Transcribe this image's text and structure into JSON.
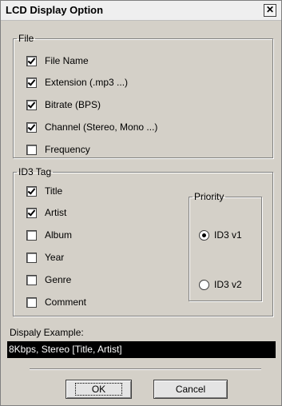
{
  "dialog": {
    "title": "LCD Display Option",
    "close_glyph": "✕"
  },
  "file_group": {
    "legend": "File",
    "items": [
      {
        "label": "File Name",
        "checked": true
      },
      {
        "label": "Extension (.mp3 ...)",
        "checked": true
      },
      {
        "label": "Bitrate (BPS)",
        "checked": true
      },
      {
        "label": "Channel (Stereo, Mono ...)",
        "checked": true
      },
      {
        "label": "Frequency",
        "checked": false
      }
    ]
  },
  "id3_group": {
    "legend": "ID3 Tag",
    "items": [
      {
        "label": "Title",
        "checked": true
      },
      {
        "label": "Artist",
        "checked": true
      },
      {
        "label": "Album",
        "checked": false
      },
      {
        "label": "Year",
        "checked": false
      },
      {
        "label": "Genre",
        "checked": false
      },
      {
        "label": "Comment",
        "checked": false
      }
    ],
    "priority": {
      "legend": "Priority",
      "options": [
        {
          "label": "ID3 v1",
          "selected": true
        },
        {
          "label": "ID3 v2",
          "selected": false
        }
      ]
    }
  },
  "example": {
    "label": "Dispaly Example:",
    "value": "8Kbps, Stereo [Title, Artist]"
  },
  "buttons": {
    "ok_label": "OK",
    "cancel_label": "Cancel"
  },
  "colors": {
    "dialog_bg": "#d4d0c8",
    "example_bg": "#000000",
    "example_fg": "#ffffff"
  }
}
